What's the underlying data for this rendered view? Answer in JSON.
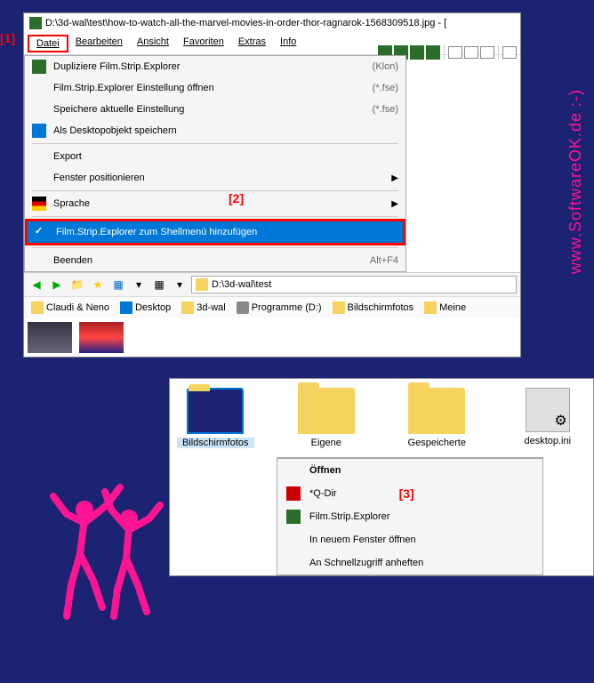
{
  "watermark": "www.SoftwareOK.de  :-)",
  "window1": {
    "title": "D:\\3d-wal\\test\\how-to-watch-all-the-marvel-movies-in-order-thor-ragnarok-1568309518.jpg - [",
    "menubar": [
      "Datei",
      "Bearbeiten",
      "Ansicht",
      "Favoriten",
      "Extras",
      "Info"
    ],
    "dropdown": [
      {
        "icon": "green",
        "label": "Dupliziere Film.Strip.Explorer",
        "shortcut": "(Klon)"
      },
      {
        "icon": "",
        "label": "Film.Strip.Explorer Einstellung öffnen",
        "shortcut": "(*.fse)"
      },
      {
        "icon": "",
        "label": "Speichere  aktuelle Einstellung",
        "shortcut": "(*.fse)"
      },
      {
        "icon": "blue",
        "label": "Als Desktopobjekt speichern",
        "shortcut": ""
      },
      {
        "sep": true
      },
      {
        "icon": "",
        "label": "Export",
        "shortcut": ""
      },
      {
        "icon": "",
        "label": "Fenster positionieren",
        "arrow": true
      },
      {
        "sep": true
      },
      {
        "icon": "flag",
        "label": "Sprache",
        "arrow": true
      },
      {
        "sep": true
      },
      {
        "icon": "check",
        "label": "Film.Strip.Explorer zum Shellmenü hinzufügen",
        "selected": true
      },
      {
        "sep": true
      },
      {
        "icon": "",
        "label": "Beenden",
        "shortcut": "Alt+F4"
      }
    ],
    "path": "D:\\3d-wal\\test",
    "favorites": [
      {
        "icon": "folder",
        "label": "Claudi & Neno"
      },
      {
        "icon": "blue",
        "label": "Desktop"
      },
      {
        "icon": "folder",
        "label": "3d-wal"
      },
      {
        "icon": "disk",
        "label": "Programme (D:)"
      },
      {
        "icon": "folder",
        "label": "Bildschirmfotos"
      },
      {
        "icon": "folder",
        "label": "Meine"
      }
    ]
  },
  "window2": {
    "folders": [
      {
        "name": "Bildschirmfotos",
        "selected": true
      },
      {
        "name": "Eigene"
      },
      {
        "name": "Gespeicherte"
      },
      {
        "name": "desktop.ini",
        "type": "ini"
      }
    ],
    "context": [
      {
        "label": "Öffnen",
        "bold": true
      },
      {
        "icon": "red",
        "label": "*Q-Dir",
        "annotation": "[3]"
      },
      {
        "icon": "green",
        "label": "Film.Strip.Explorer"
      },
      {
        "label": "In neuem Fenster öffnen"
      },
      {
        "label": "An Schnellzugriff anheften"
      }
    ]
  },
  "annotations": {
    "a1": "[1]",
    "a2": "[2]",
    "a3": "[3]"
  }
}
